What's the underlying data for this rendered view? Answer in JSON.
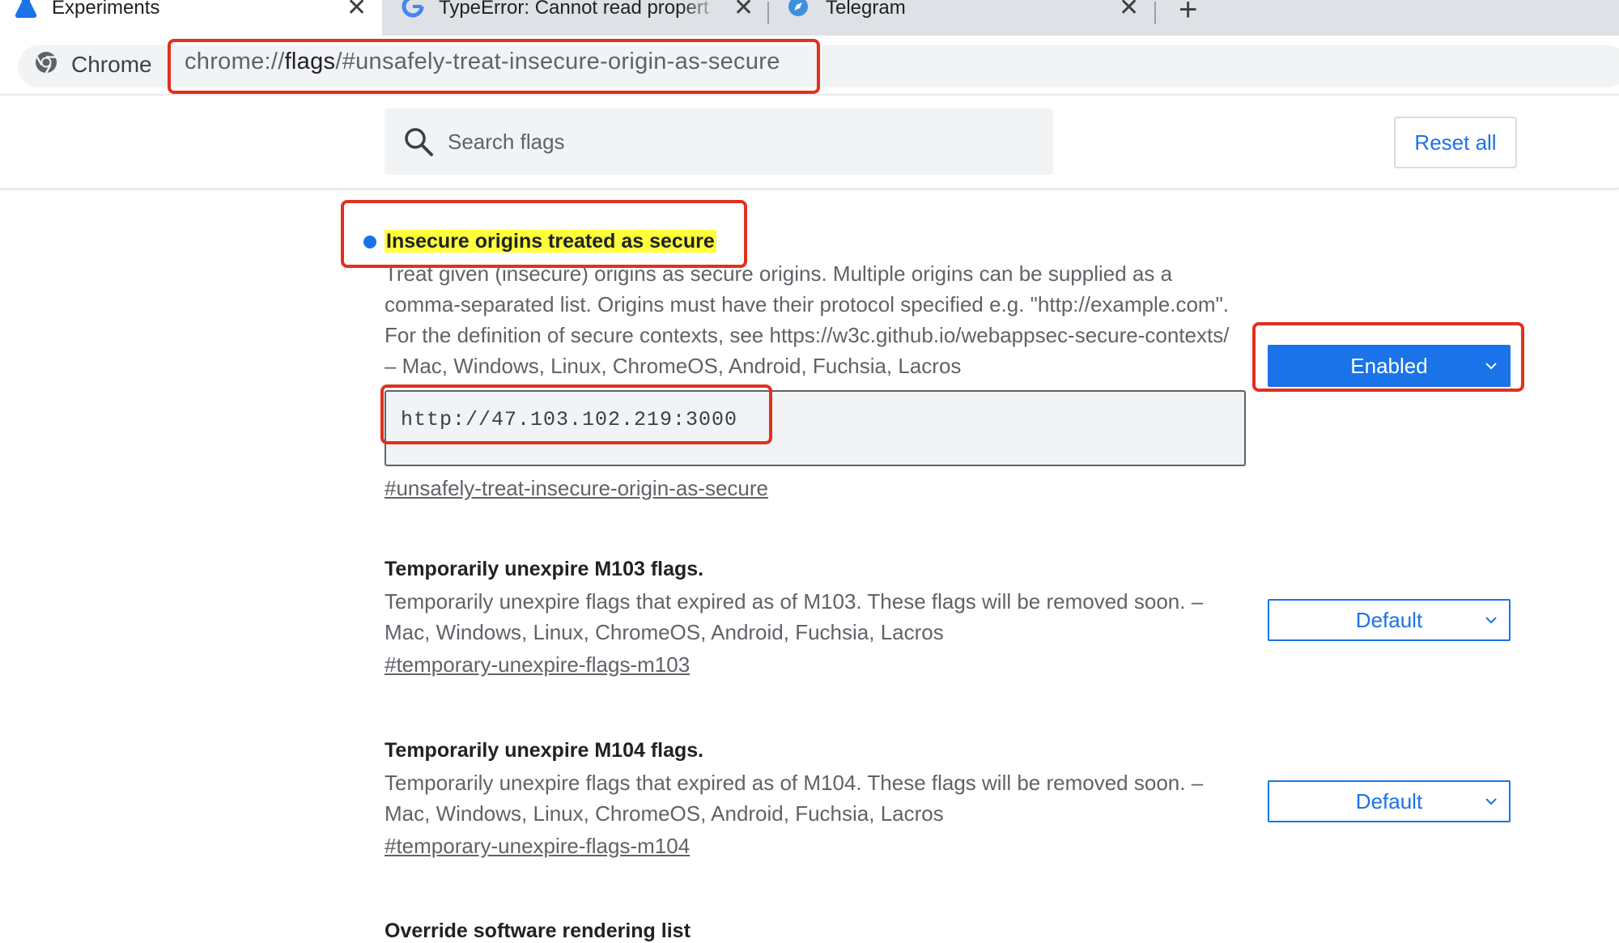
{
  "tabs": [
    {
      "title": "Experiments",
      "active": true,
      "icon": "flask-icon"
    },
    {
      "title": "TypeError: Cannot read propert",
      "active": false,
      "icon": "google-icon"
    },
    {
      "title": "Telegram",
      "active": false,
      "icon": "compass-icon"
    }
  ],
  "tab_close_glyph": "✕",
  "new_tab_glyph": "+",
  "omnibox": {
    "chip_label": "Chrome",
    "url_scheme": "chrome://",
    "url_host": "flags",
    "url_rest": "/#unsafely-treat-insecure-origin-as-secure"
  },
  "header": {
    "search_placeholder": "Search flags",
    "reset_label": "Reset all"
  },
  "experiments": [
    {
      "title": "Insecure origins treated as secure",
      "description": "Treat given (insecure) origins as secure origins. Multiple origins can be supplied as a comma-separated list. Origins must have their protocol specified e.g. \"http://example.com\". For the definition of secure contexts, see https://w3c.github.io/webappsec-secure-contexts/ – Mac, Windows, Linux, ChromeOS, Android, Fuchsia, Lacros",
      "origins_value": "http://47.103.102.219:3000",
      "link": "#unsafely-treat-insecure-origin-as-secure",
      "state": "Enabled"
    },
    {
      "title": "Temporarily unexpire M103 flags.",
      "description": "Temporarily unexpire flags that expired as of M103. These flags will be removed soon. – Mac, Windows, Linux, ChromeOS, Android, Fuchsia, Lacros",
      "link": "#temporary-unexpire-flags-m103",
      "state": "Default"
    },
    {
      "title": "Temporarily unexpire M104 flags.",
      "description": "Temporarily unexpire flags that expired as of M104. These flags will be removed soon. – Mac, Windows, Linux, ChromeOS, Android, Fuchsia, Lacros",
      "link": "#temporary-unexpire-flags-m104",
      "state": "Default"
    },
    {
      "title": "Override software rendering list"
    }
  ],
  "colors": {
    "accent": "#1a73e8",
    "annotation": "#e0311f",
    "highlight": "#ffff3c"
  }
}
